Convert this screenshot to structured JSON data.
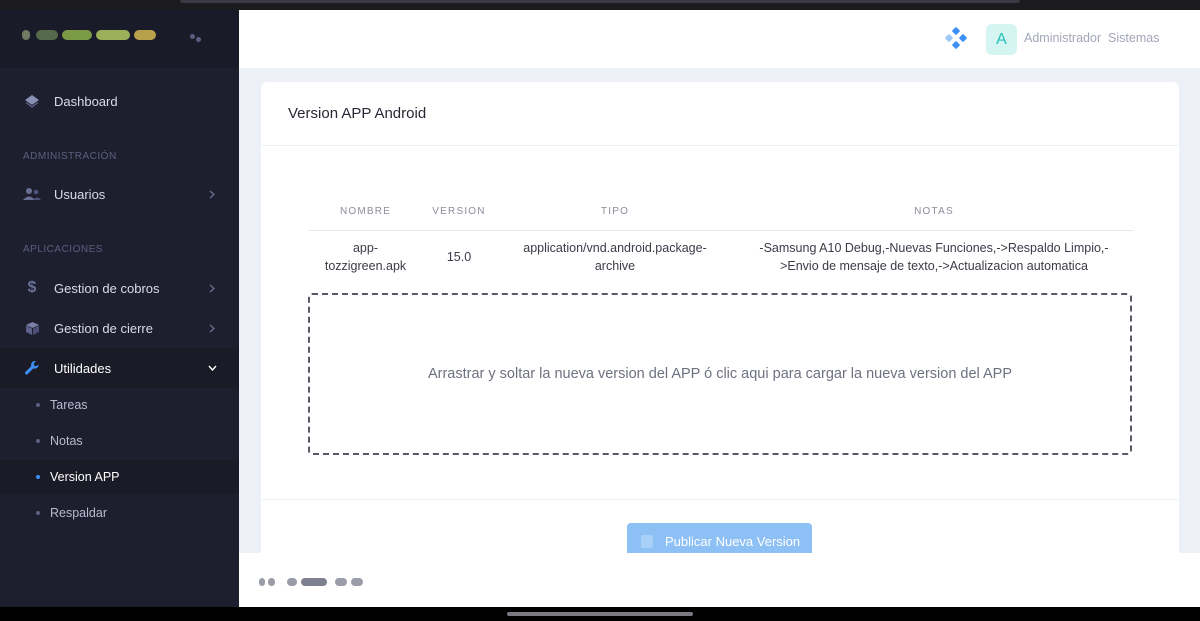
{
  "sidebar": {
    "dashboard": "Dashboard",
    "section_admin": "ADMINISTRACIÓN",
    "usuarios": "Usuarios",
    "section_apps": "APLICACIONES",
    "cobros": "Gestion de cobros",
    "cierre": "Gestion de cierre",
    "utilidades": "Utilidades",
    "sub": [
      "Tareas",
      "Notas",
      "Version APP",
      "Respaldar"
    ]
  },
  "header": {
    "avatar_letter": "A",
    "user_name": "Administrador  Sistemas"
  },
  "card": {
    "title": "Version APP Android",
    "columns": [
      "NOMBRE",
      "VERSION",
      "TIPO",
      "NOTAS"
    ],
    "row": {
      "nombre": "app-tozzigreen.apk",
      "version": "15.0",
      "tipo": "application/vnd.android.package-archive",
      "notas": "-Samsung A10 Debug,-Nuevas Funciones,->Respaldo Limpio,->Envio de mensaje de texto,->Actualizacion automatica"
    },
    "dropzone_text": "Arrastrar y soltar la nueva version del APP ó clic aqui para cargar la nueva version del APP",
    "publish_label": "Publicar Nueva Version"
  },
  "colors": {
    "sidebar_bg": "#1e1f2e",
    "accent": "#3d8ff5",
    "publish_bg": "#8dc0f5",
    "avatar_bg": "#d5f5f3",
    "avatar_fg": "#22c1b8"
  },
  "icons": {
    "dashboard": "layers-icon",
    "usuarios": "users-icon",
    "cobros": "dollar-icon",
    "cierre": "box-icon",
    "utilidades": "wrench-icon",
    "header": "apps-diamond-icon",
    "publish": "file-icon"
  }
}
